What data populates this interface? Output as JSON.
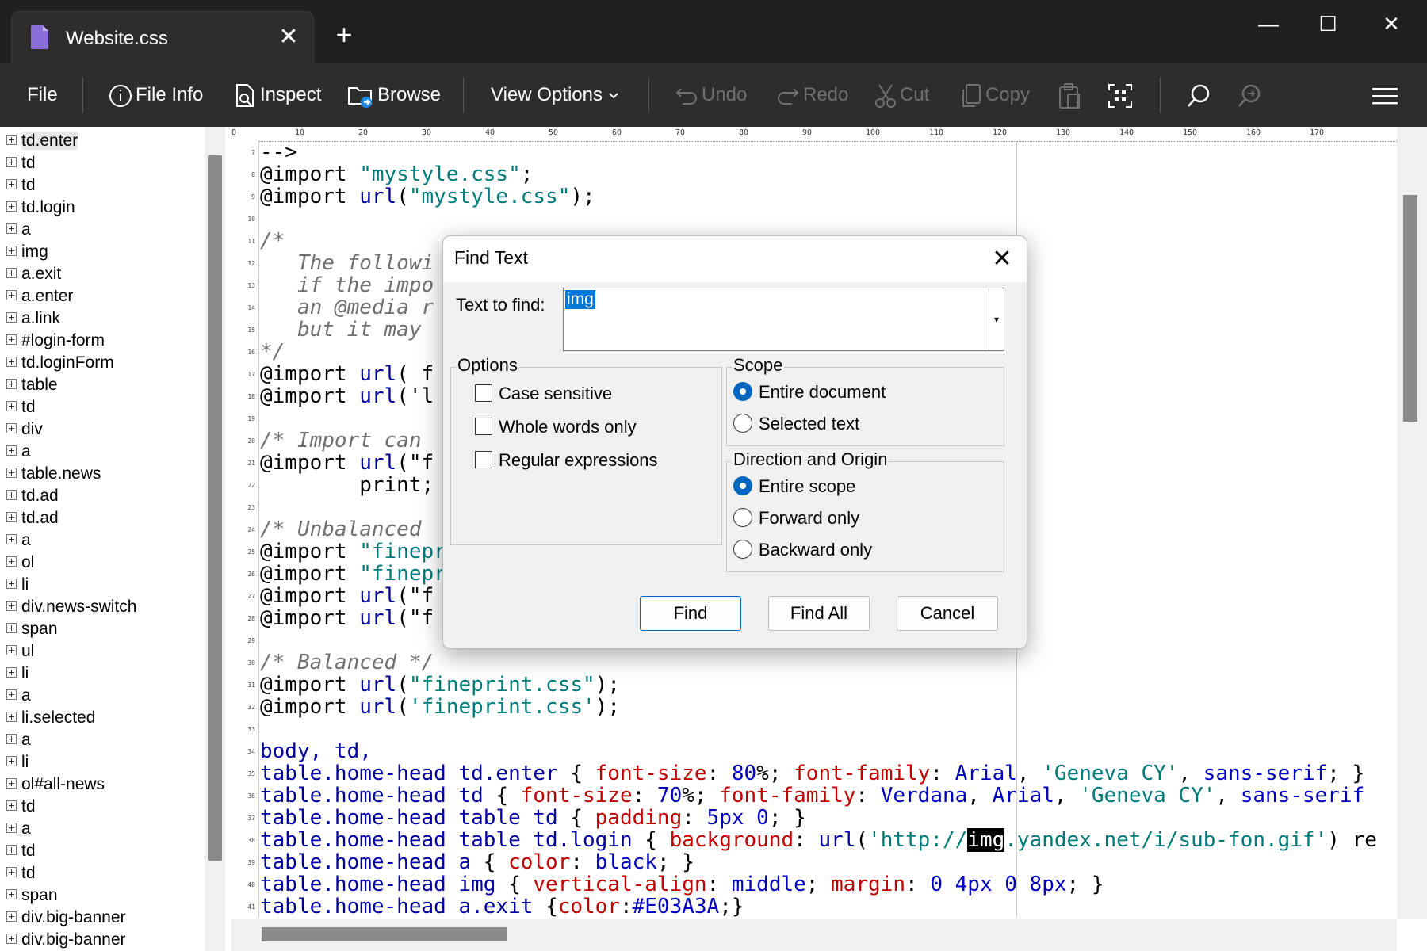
{
  "window": {
    "tab_title": "Website.css",
    "tab_close": "✕",
    "new_tab": "+",
    "minimize": "—",
    "maximize": "☐",
    "close": "✕"
  },
  "toolbar": {
    "file": "File",
    "file_info": "File Info",
    "inspect": "Inspect",
    "browse": "Browse",
    "view_options": "View Options",
    "undo": "Undo",
    "redo": "Redo",
    "cut": "Cut",
    "copy": "Copy"
  },
  "tree": {
    "items": [
      "td.enter",
      "td",
      "td",
      "td.login",
      "a",
      "img",
      "a.exit",
      "a.enter",
      "a.link",
      "#login-form",
      "td.loginForm",
      "table",
      "td",
      "div",
      "a",
      "table.news",
      "td.ad",
      "td.ad",
      "a",
      "ol",
      "li",
      "div.news-switch",
      "span",
      "ul",
      "li",
      "a",
      "li.selected",
      "a",
      "li",
      "ol#all-news",
      "td",
      "a",
      "td",
      "td",
      "span",
      "div.big-banner",
      "div.big-banner"
    ]
  },
  "ruler": {
    "ticks": [
      "0",
      "10",
      "20",
      "30",
      "40",
      "50",
      "60",
      "70",
      "80",
      "90",
      "100",
      "110",
      "120",
      "130",
      "140",
      "150",
      "160",
      "170"
    ]
  },
  "editor": {
    "line_numbers": [
      "7",
      "8",
      "9",
      "10",
      "11",
      "12",
      "13",
      "14",
      "15",
      "16",
      "17",
      "18",
      "19",
      "20",
      "21",
      "22",
      "23",
      "24",
      "25",
      "26",
      "27",
      "28",
      "29",
      "30",
      "31",
      "32",
      "33",
      "34",
      "35",
      "36",
      "37",
      "38",
      "39",
      "40",
      "41"
    ],
    "lines": [
      [
        {
          "t": "-->",
          "c": "kw"
        }
      ],
      [
        {
          "t": "@import ",
          "c": "kw"
        },
        {
          "t": "\"mystyle.css\"",
          "c": "str"
        },
        {
          "t": ";",
          "c": "kw"
        }
      ],
      [
        {
          "t": "@import ",
          "c": "kw"
        },
        {
          "t": "url",
          "c": "url"
        },
        {
          "t": "(",
          "c": "kw"
        },
        {
          "t": "\"mystyle.css\"",
          "c": "str"
        },
        {
          "t": ");",
          "c": "kw"
        }
      ],
      [],
      [
        {
          "t": "/*",
          "c": "com"
        }
      ],
      [
        {
          "t": "   The followi",
          "c": "com"
        }
      ],
      [
        {
          "t": "   if the impo",
          "c": "com"
        }
      ],
      [
        {
          "t": "   an @media r",
          "c": "com"
        }
      ],
      [
        {
          "t": "   but it may ",
          "c": "com"
        }
      ],
      [
        {
          "t": "*/",
          "c": "com"
        }
      ],
      [
        {
          "t": "@import ",
          "c": "kw"
        },
        {
          "t": "url",
          "c": "url"
        },
        {
          "t": "( f",
          "c": "kw"
        }
      ],
      [
        {
          "t": "@import ",
          "c": "kw"
        },
        {
          "t": "url",
          "c": "url"
        },
        {
          "t": "('l",
          "c": "kw"
        }
      ],
      [],
      [
        {
          "t": "/* Import can ",
          "c": "com"
        }
      ],
      [
        {
          "t": "@import ",
          "c": "kw"
        },
        {
          "t": "url",
          "c": "url"
        },
        {
          "t": "(\"f",
          "c": "kw"
        }
      ],
      [
        {
          "t": "        print;",
          "c": "kw"
        }
      ],
      [],
      [
        {
          "t": "/* Unbalanced ",
          "c": "com"
        }
      ],
      [
        {
          "t": "@import ",
          "c": "kw"
        },
        {
          "t": "\"finepr",
          "c": "str"
        }
      ],
      [
        {
          "t": "@import ",
          "c": "kw"
        },
        {
          "t": "\"finepr",
          "c": "str"
        }
      ],
      [
        {
          "t": "@import ",
          "c": "kw"
        },
        {
          "t": "url",
          "c": "url"
        },
        {
          "t": "(\"f",
          "c": "kw"
        }
      ],
      [
        {
          "t": "@import ",
          "c": "kw"
        },
        {
          "t": "url",
          "c": "url"
        },
        {
          "t": "(\"f",
          "c": "kw"
        }
      ],
      [],
      [
        {
          "t": "/* Balanced */",
          "c": "com"
        }
      ],
      [
        {
          "t": "@import ",
          "c": "kw"
        },
        {
          "t": "url",
          "c": "url"
        },
        {
          "t": "(",
          "c": "kw"
        },
        {
          "t": "\"fineprint.css\"",
          "c": "str"
        },
        {
          "t": ");",
          "c": "kw"
        }
      ],
      [
        {
          "t": "@import ",
          "c": "kw"
        },
        {
          "t": "url",
          "c": "url"
        },
        {
          "t": "(",
          "c": "kw"
        },
        {
          "t": "'fineprint.css'",
          "c": "str"
        },
        {
          "t": ");",
          "c": "kw"
        }
      ],
      [],
      [
        {
          "t": "body, td,",
          "c": "url"
        }
      ],
      [
        {
          "t": "table.home-head td.enter ",
          "c": "url"
        },
        {
          "t": "{ ",
          "c": "kw"
        },
        {
          "t": "font-size",
          "c": "prop"
        },
        {
          "t": ": ",
          "c": "kw"
        },
        {
          "t": "80",
          "c": "num"
        },
        {
          "t": "%; ",
          "c": "kw"
        },
        {
          "t": "font-family",
          "c": "prop"
        },
        {
          "t": ": ",
          "c": "kw"
        },
        {
          "t": "Arial",
          "c": "val"
        },
        {
          "t": ", ",
          "c": "kw"
        },
        {
          "t": "'Geneva CY'",
          "c": "str"
        },
        {
          "t": ", ",
          "c": "kw"
        },
        {
          "t": "sans-serif",
          "c": "val"
        },
        {
          "t": "; }",
          "c": "kw"
        }
      ],
      [
        {
          "t": "table.home-head td ",
          "c": "url"
        },
        {
          "t": "{ ",
          "c": "kw"
        },
        {
          "t": "font-size",
          "c": "prop"
        },
        {
          "t": ": ",
          "c": "kw"
        },
        {
          "t": "70",
          "c": "num"
        },
        {
          "t": "%; ",
          "c": "kw"
        },
        {
          "t": "font-family",
          "c": "prop"
        },
        {
          "t": ": ",
          "c": "kw"
        },
        {
          "t": "Verdana",
          "c": "val"
        },
        {
          "t": ", ",
          "c": "kw"
        },
        {
          "t": "Arial",
          "c": "val"
        },
        {
          "t": ", ",
          "c": "kw"
        },
        {
          "t": "'Geneva CY'",
          "c": "str"
        },
        {
          "t": ", ",
          "c": "kw"
        },
        {
          "t": "sans-serif",
          "c": "val"
        }
      ],
      [
        {
          "t": "table.home-head table td ",
          "c": "url"
        },
        {
          "t": "{ ",
          "c": "kw"
        },
        {
          "t": "padding",
          "c": "prop"
        },
        {
          "t": ": ",
          "c": "kw"
        },
        {
          "t": "5px 0",
          "c": "num"
        },
        {
          "t": "; }",
          "c": "kw"
        }
      ],
      [
        {
          "t": "table.home-head table td.login ",
          "c": "url"
        },
        {
          "t": "{ ",
          "c": "kw"
        },
        {
          "t": "background",
          "c": "prop"
        },
        {
          "t": ": ",
          "c": "kw"
        },
        {
          "t": "url",
          "c": "url"
        },
        {
          "t": "(",
          "c": "kw"
        },
        {
          "t": "'http://",
          "c": "str"
        },
        {
          "t": "img",
          "c": "hl"
        },
        {
          "t": ".yandex.net/i/sub-fon.gif'",
          "c": "str"
        },
        {
          "t": ") re",
          "c": "kw"
        }
      ],
      [
        {
          "t": "table.home-head a ",
          "c": "url"
        },
        {
          "t": "{ ",
          "c": "kw"
        },
        {
          "t": "color",
          "c": "prop"
        },
        {
          "t": ": ",
          "c": "kw"
        },
        {
          "t": "black",
          "c": "val"
        },
        {
          "t": "; }",
          "c": "kw"
        }
      ],
      [
        {
          "t": "table.home-head img ",
          "c": "url"
        },
        {
          "t": "{ ",
          "c": "kw"
        },
        {
          "t": "vertical-align",
          "c": "prop"
        },
        {
          "t": ": ",
          "c": "kw"
        },
        {
          "t": "middle",
          "c": "val"
        },
        {
          "t": "; ",
          "c": "kw"
        },
        {
          "t": "margin",
          "c": "prop"
        },
        {
          "t": ": ",
          "c": "kw"
        },
        {
          "t": "0 4px 0 8px",
          "c": "num"
        },
        {
          "t": "; }",
          "c": "kw"
        }
      ],
      [
        {
          "t": "table.home-head a.exit ",
          "c": "url"
        },
        {
          "t": "{",
          "c": "kw"
        },
        {
          "t": "color",
          "c": "prop"
        },
        {
          "t": ":",
          "c": "kw"
        },
        {
          "t": "#E03A3A",
          "c": "val"
        },
        {
          "t": ";}",
          "c": "kw"
        }
      ]
    ]
  },
  "dialog": {
    "title": "Find Text",
    "close": "✕",
    "text_to_find_label": "Text to find:",
    "text_to_find_value": "img",
    "options_title": "Options",
    "case_sensitive": "Case sensitive",
    "whole_words": "Whole words only",
    "regex": "Regular expressions",
    "scope_title": "Scope",
    "entire_document": "Entire document",
    "selected_text": "Selected text",
    "direction_title": "Direction and Origin",
    "entire_scope": "Entire scope",
    "forward_only": "Forward only",
    "backward_only": "Backward only",
    "find_btn": "Find",
    "find_all_btn": "Find All",
    "cancel_btn": "Cancel"
  },
  "colors": {
    "titlebar": "#202020",
    "toolbar": "#2d2d2d",
    "accent": "#0067c0",
    "tab_icon": "#8b6fd6"
  }
}
